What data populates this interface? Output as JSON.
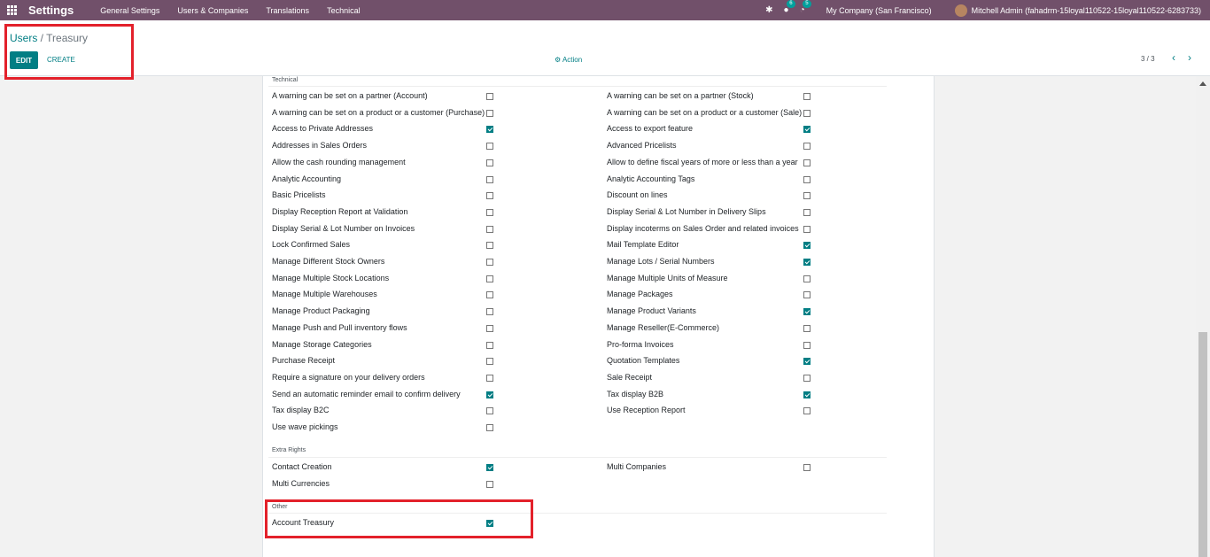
{
  "navbar": {
    "app_title": "Settings",
    "menu": [
      "General Settings",
      "Users & Companies",
      "Translations",
      "Technical"
    ],
    "bug_icon": "bug-icon",
    "chat_badge": "6",
    "activity_badge": "5",
    "company": "My Company (San Francisco)",
    "user": "Mitchell Admin (fahadrm-15loyal110522-15loyal110522-6283733)"
  },
  "breadcrumb": {
    "parent": "Users",
    "separator": " / ",
    "current": "Treasury"
  },
  "buttons": {
    "edit": "EDIT",
    "create": "CREATE",
    "action": "Action"
  },
  "pager": {
    "text": "3 / 3",
    "prev": "‹",
    "next": "›"
  },
  "colors": {
    "navbar": "#71506a",
    "accent": "#017e84",
    "highlight": "#e3212b"
  },
  "technical": {
    "title": "Technical",
    "left": [
      {
        "label": "A warning can be set on a partner (Account)",
        "checked": false
      },
      {
        "label": "A warning can be set on a product or a customer (Purchase)",
        "checked": false
      },
      {
        "label": "Access to Private Addresses",
        "checked": true
      },
      {
        "label": "Addresses in Sales Orders",
        "checked": false
      },
      {
        "label": "Allow the cash rounding management",
        "checked": false
      },
      {
        "label": "Analytic Accounting",
        "checked": false
      },
      {
        "label": "Basic Pricelists",
        "checked": false
      },
      {
        "label": "Display Reception Report at Validation",
        "checked": false
      },
      {
        "label": "Display Serial & Lot Number on Invoices",
        "checked": false
      },
      {
        "label": "Lock Confirmed Sales",
        "checked": false
      },
      {
        "label": "Manage Different Stock Owners",
        "checked": false
      },
      {
        "label": "Manage Multiple Stock Locations",
        "checked": false
      },
      {
        "label": "Manage Multiple Warehouses",
        "checked": false
      },
      {
        "label": "Manage Product Packaging",
        "checked": false
      },
      {
        "label": "Manage Push and Pull inventory flows",
        "checked": false
      },
      {
        "label": "Manage Storage Categories",
        "checked": false
      },
      {
        "label": "Purchase Receipt",
        "checked": false
      },
      {
        "label": "Require a signature on your delivery orders",
        "checked": false
      },
      {
        "label": "Send an automatic reminder email to confirm delivery",
        "checked": true
      },
      {
        "label": "Tax display B2C",
        "checked": false
      },
      {
        "label": "Use wave pickings",
        "checked": false
      }
    ],
    "right": [
      {
        "label": "A warning can be set on a partner (Stock)",
        "checked": false
      },
      {
        "label": "A warning can be set on a product or a customer (Sale)",
        "checked": false
      },
      {
        "label": "Access to export feature",
        "checked": true
      },
      {
        "label": "Advanced Pricelists",
        "checked": false
      },
      {
        "label": "Allow to define fiscal years of more or less than a year",
        "checked": false
      },
      {
        "label": "Analytic Accounting Tags",
        "checked": false
      },
      {
        "label": "Discount on lines",
        "checked": false
      },
      {
        "label": "Display Serial & Lot Number in Delivery Slips",
        "checked": false
      },
      {
        "label": "Display incoterms on Sales Order and related invoices",
        "checked": false
      },
      {
        "label": "Mail Template Editor",
        "checked": true
      },
      {
        "label": "Manage Lots / Serial Numbers",
        "checked": true
      },
      {
        "label": "Manage Multiple Units of Measure",
        "checked": false
      },
      {
        "label": "Manage Packages",
        "checked": false
      },
      {
        "label": "Manage Product Variants",
        "checked": true
      },
      {
        "label": "Manage Reseller(E-Commerce)",
        "checked": false
      },
      {
        "label": "Pro-forma Invoices",
        "checked": false
      },
      {
        "label": "Quotation Templates",
        "checked": true
      },
      {
        "label": "Sale Receipt",
        "checked": false
      },
      {
        "label": "Tax display B2B",
        "checked": true
      },
      {
        "label": "Use Reception Report",
        "checked": false
      }
    ]
  },
  "extra_rights": {
    "title": "Extra Rights",
    "left": [
      {
        "label": "Contact Creation",
        "checked": true
      },
      {
        "label": "Multi Currencies",
        "checked": false
      }
    ],
    "right": [
      {
        "label": "Multi Companies",
        "checked": false
      }
    ]
  },
  "other": {
    "title": "Other",
    "left": [
      {
        "label": "Account Treasury",
        "checked": true
      }
    ]
  }
}
